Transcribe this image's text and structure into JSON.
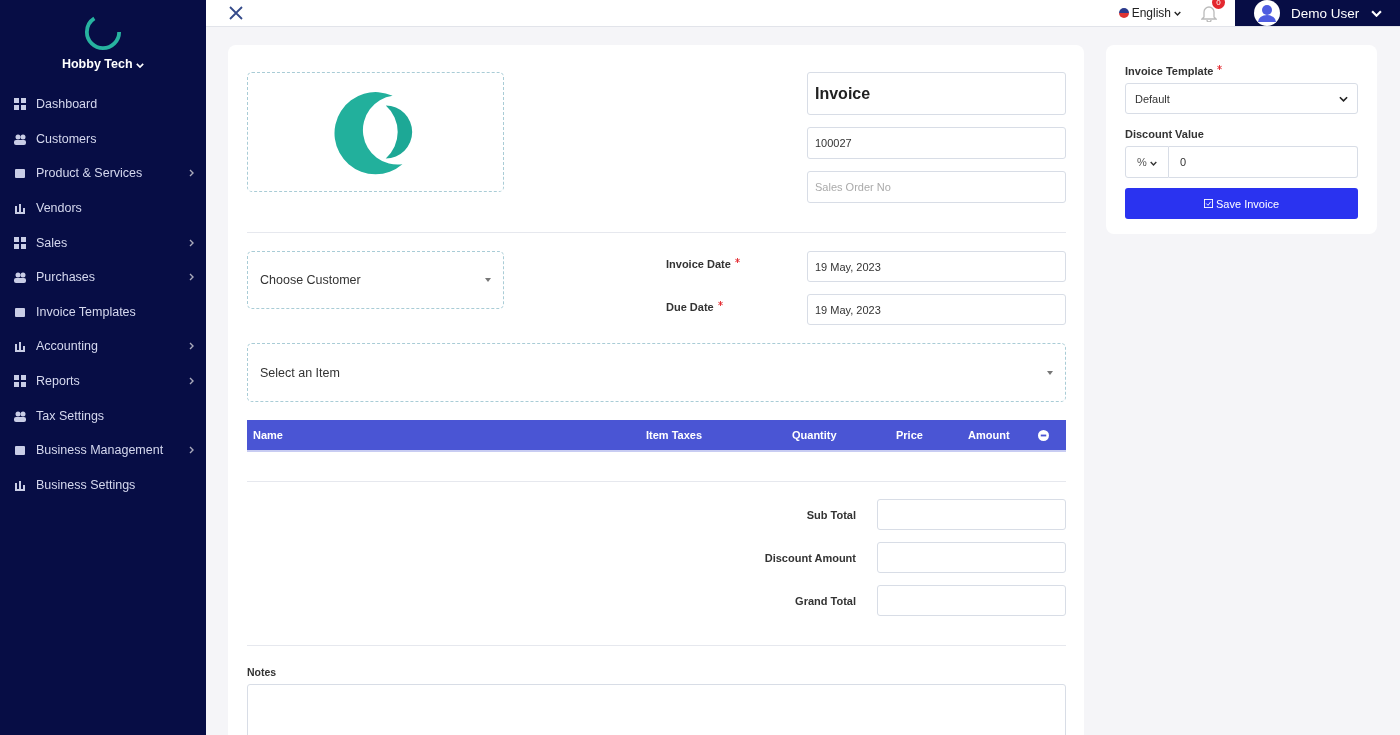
{
  "sidebar": {
    "company": "Hobby Tech",
    "items": [
      {
        "label": "Dashboard",
        "has_submenu": false
      },
      {
        "label": "Customers",
        "has_submenu": false
      },
      {
        "label": "Product & Services",
        "has_submenu": true
      },
      {
        "label": "Vendors",
        "has_submenu": false
      },
      {
        "label": "Sales",
        "has_submenu": true
      },
      {
        "label": "Purchases",
        "has_submenu": true
      },
      {
        "label": "Invoice Templates",
        "has_submenu": false
      },
      {
        "label": "Accounting",
        "has_submenu": true
      },
      {
        "label": "Reports",
        "has_submenu": true
      },
      {
        "label": "Tax Settings",
        "has_submenu": false
      },
      {
        "label": "Business Management",
        "has_submenu": true
      },
      {
        "label": "Business Settings",
        "has_submenu": false
      }
    ]
  },
  "topbar": {
    "language": "English",
    "notifications": "0",
    "user": "Demo User"
  },
  "invoice": {
    "title": "Invoice",
    "number": "100027",
    "sales_order": {
      "placeholder": "Sales Order No"
    },
    "customer": {
      "placeholder": "Choose Customer"
    },
    "dates": [
      {
        "label": "Invoice Date",
        "required": true,
        "value": "19 May, 2023"
      },
      {
        "label": "Due Date",
        "required": true,
        "value": "19 May, 2023"
      }
    ],
    "item_select": {
      "placeholder": "Select an Item"
    },
    "table": {
      "columns": [
        "Name",
        "Item Taxes",
        "Quantity",
        "Price",
        "Amount"
      ]
    },
    "totals": [
      {
        "label": "Sub Total"
      },
      {
        "label": "Discount Amount"
      },
      {
        "label": "Grand Total"
      }
    ],
    "notes_label": "Notes"
  },
  "settings": {
    "template": {
      "label": "Invoice Template",
      "required": true,
      "value": "Default"
    },
    "discount": {
      "label": "Discount Value",
      "unit": "%",
      "value": "0"
    },
    "save_button": "Save Invoice"
  }
}
